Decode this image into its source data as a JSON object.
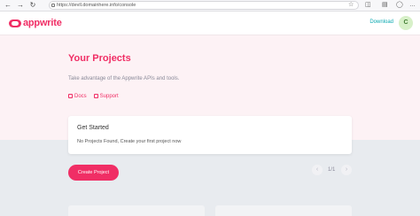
{
  "browser": {
    "back_glyph": "←",
    "forward_glyph": "→",
    "reload_glyph": "↻",
    "url": "https://devll.domainhere.info/console",
    "favorite_glyph": "☆",
    "extensions_glyph": "◫",
    "collections_glyph": "▤",
    "profile_glyph": "◯",
    "menu_glyph": "…"
  },
  "header": {
    "logo_text": "appwrite",
    "download_label": "Download",
    "avatar_initial": "C"
  },
  "hero": {
    "title": "Your Projects",
    "subtitle": "Take advantage of the Appwrite APIs and tools.",
    "links": [
      {
        "label": "Docs"
      },
      {
        "label": "Support"
      }
    ]
  },
  "card": {
    "title": "Get Started",
    "text": "No Projects Found, Create your first project now"
  },
  "actions": {
    "create_label": "Create Project"
  },
  "pagination": {
    "prev_glyph": "‹",
    "page_label": "1/1",
    "next_glyph": "›"
  },
  "colors": {
    "brand": "#f02e65",
    "link": "#0aa8b0"
  }
}
